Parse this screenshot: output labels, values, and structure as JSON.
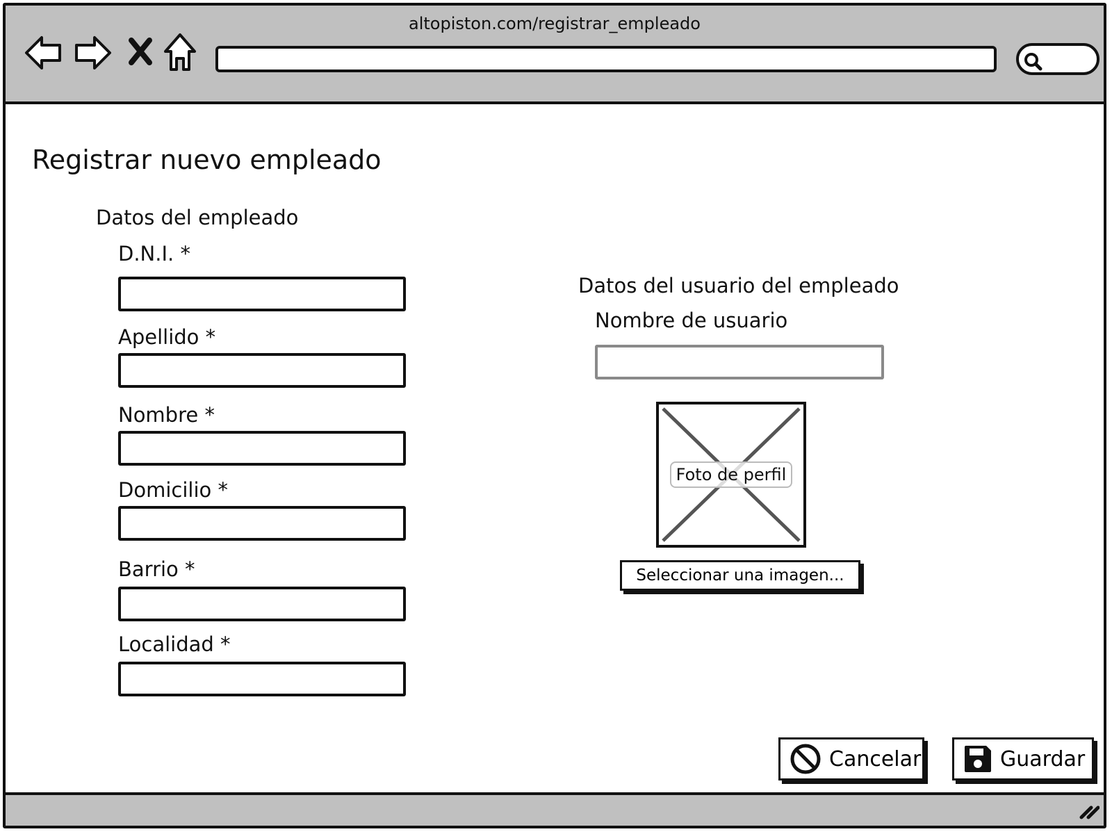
{
  "browser": {
    "url": "altopiston.com/registrar_empleado",
    "address_value": ""
  },
  "page": {
    "title": "Registrar nuevo empleado"
  },
  "employee_section": {
    "title": "Datos del empleado",
    "fields": [
      {
        "label": "D.N.I. *",
        "value": ""
      },
      {
        "label": "Apellido *",
        "value": ""
      },
      {
        "label": "Nombre *",
        "value": ""
      },
      {
        "label": "Domicilio *",
        "value": ""
      },
      {
        "label": "Barrio *",
        "value": ""
      },
      {
        "label": "Localidad *",
        "value": ""
      }
    ]
  },
  "user_section": {
    "title": "Datos del usuario del empleado",
    "username_label": "Nombre de usuario",
    "username_value": "",
    "photo_label": "Foto de perfil",
    "select_image_label": "Seleccionar una imagen..."
  },
  "actions": {
    "cancel_label": "Cancelar",
    "save_label": "Guardar"
  },
  "icons": {
    "back": "back-arrow-icon",
    "forward": "forward-arrow-icon",
    "stop": "stop-x-icon",
    "home": "home-icon",
    "search": "search-icon",
    "cancel": "ban-icon",
    "save": "floppy-disk-icon",
    "resize": "resize-grip-icon"
  }
}
